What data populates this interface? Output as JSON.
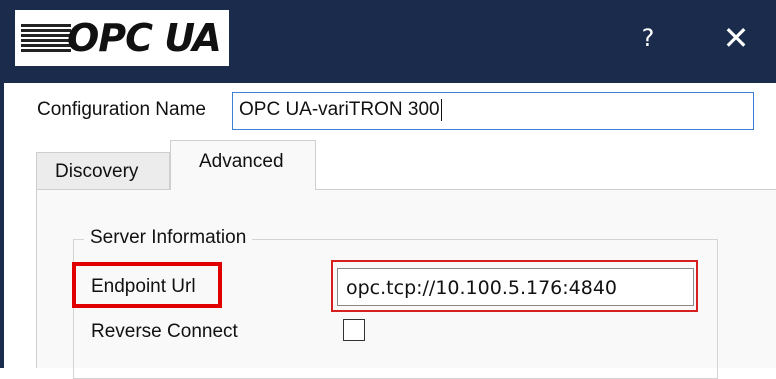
{
  "titlebar": {
    "logo_text": "OPC UA",
    "help_label": "?",
    "close_label": "✕"
  },
  "config": {
    "label": "Configuration Name",
    "value": "OPC UA-variTRON 300"
  },
  "tabs": [
    {
      "label": "Discovery"
    },
    {
      "label": "Advanced"
    }
  ],
  "server_info": {
    "legend": "Server Information",
    "endpoint_label": "Endpoint Url",
    "endpoint_value": "opc.tcp://10.100.5.176:4840",
    "reverse_label": "Reverse Connect",
    "reverse_checked": false
  },
  "colors": {
    "titlebar": "#1a2b4c",
    "highlight": "#e00000",
    "focus_border": "#3c7fd4"
  }
}
